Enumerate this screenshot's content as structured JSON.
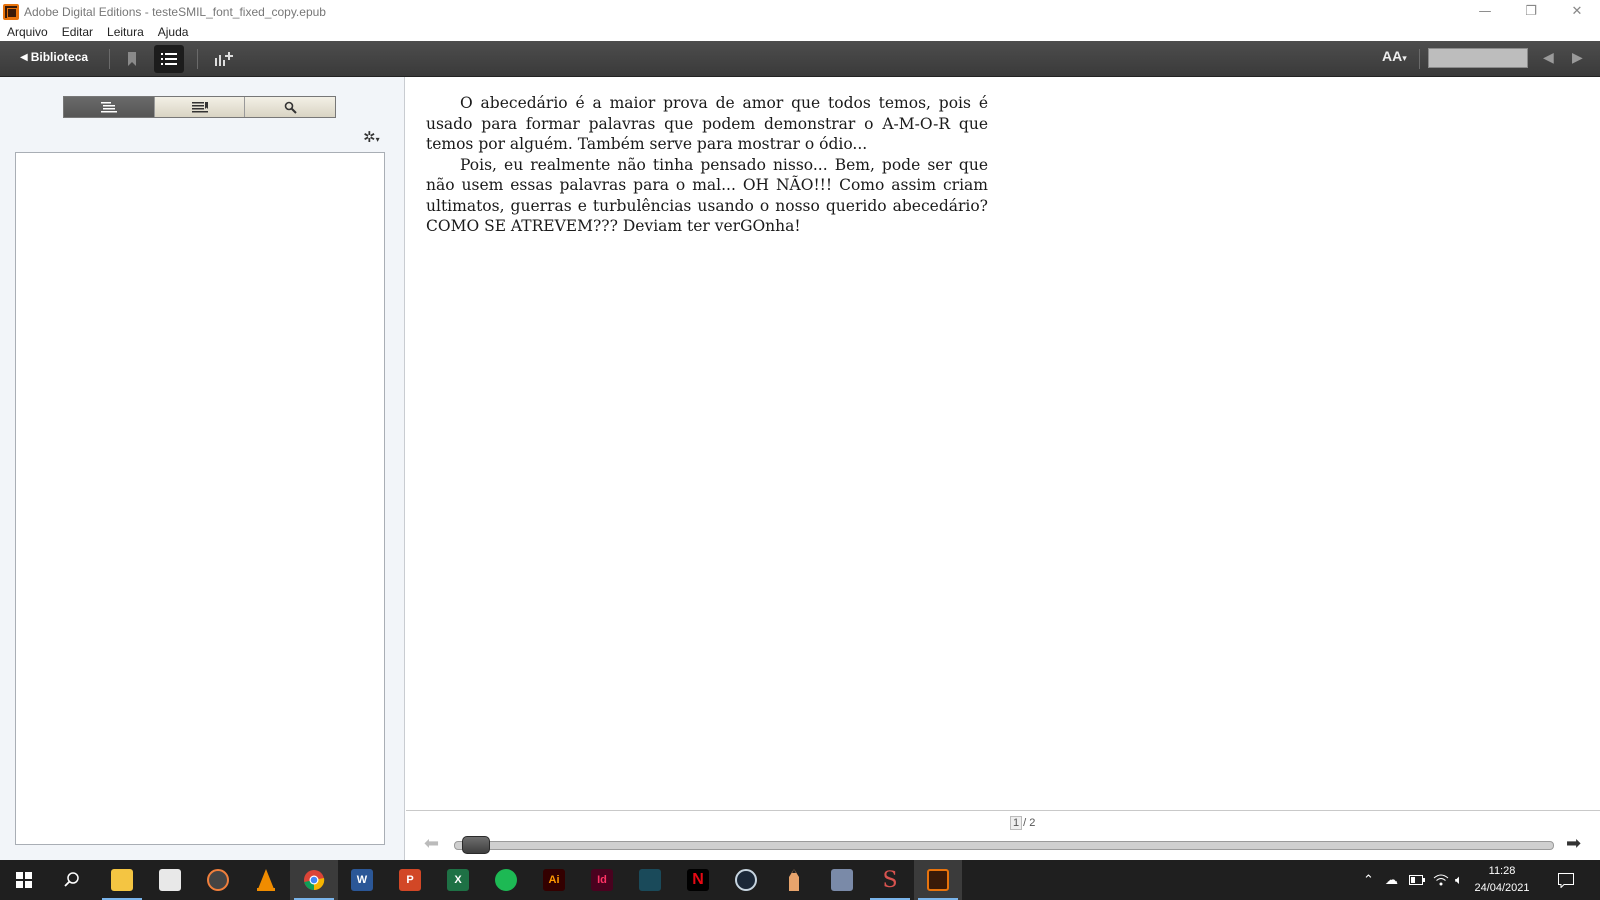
{
  "window": {
    "title": "Adobe Digital Editions - testeSMIL_font_fixed_copy.epub",
    "controls": [
      "—",
      "❐",
      "✕"
    ]
  },
  "menu": [
    "Arquivo",
    "Editar",
    "Leitura",
    "Ajuda"
  ],
  "toolbar": {
    "library_label": "Biblioteca",
    "font_label": "AA"
  },
  "book": {
    "paragraphs": [
      "O abecedário é a maior prova de amor que todos temos, pois é usado para formar palavras que podem demonstrar o A-M-O-R que temos por alguém. Também serve para mostrar o ódio...",
      "Pois, eu realmente não tinha pensado nisso... Bem, pode ser que não usem essas palavras para o mal... OH NÃO!!! Como assim criam ultimatos, guerras e turbulências usando o nosso querido abecedário? COMO SE ATREVEM??? Deviam ter verGOnha!"
    ]
  },
  "pagination": {
    "current": "1",
    "total_label": "/ 2",
    "progress": 0.0
  },
  "taskbar": {
    "clock_time": "11:28",
    "clock_date": "24/04/2021",
    "apps": [
      "file-explorer",
      "store",
      "music",
      "vlc",
      "chrome",
      "word",
      "powerpoint",
      "excel",
      "spotify",
      "illustrator",
      "indesign",
      "kindle",
      "netflix",
      "steam",
      "pencil",
      "app",
      "s-app",
      "adobe-digital-editions"
    ]
  },
  "colors": {
    "toolbar": "#444444",
    "panel": "#f2f5f9",
    "taskbar": "#1f1f1f",
    "accent": "#e8730c"
  }
}
